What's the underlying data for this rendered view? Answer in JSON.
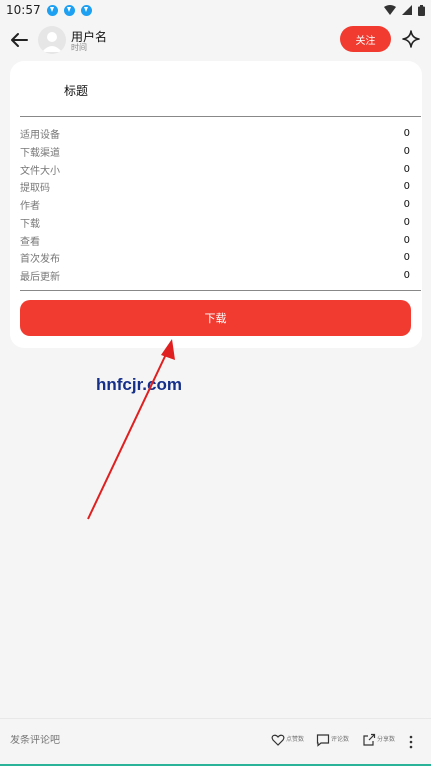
{
  "status_bar": {
    "time": "10:57",
    "notification_icons": [
      "download-icon",
      "download-icon",
      "download-icon"
    ],
    "right_icons": [
      "wifi-icon",
      "signal-icon",
      "battery-icon"
    ]
  },
  "header": {
    "back_icon": "arrow-left-icon",
    "user_name": "用户名",
    "time_label": "时间",
    "follow_label": "关注",
    "sparkle_icon": "sparkle-icon"
  },
  "card": {
    "title": "标题",
    "rows": [
      {
        "label": "适用设备",
        "value": "0"
      },
      {
        "label": "下载渠道",
        "value": "0"
      },
      {
        "label": "文件大小",
        "value": "0"
      },
      {
        "label": "提取码",
        "value": "0"
      },
      {
        "label": "作者",
        "value": "0"
      },
      {
        "label": "下载",
        "value": "0"
      },
      {
        "label": "查看",
        "value": "0"
      },
      {
        "label": "首次发布",
        "value": "0"
      },
      {
        "label": "最后更新",
        "value": "0"
      }
    ],
    "download_label": "下载"
  },
  "watermark": "hnfcjr.com",
  "bottom_bar": {
    "comment_placeholder": "发条评论吧",
    "actions": [
      {
        "icon": "heart-icon",
        "label": "点赞数"
      },
      {
        "icon": "comment-icon",
        "label": "评论数"
      },
      {
        "icon": "share-icon",
        "label": "分享数"
      }
    ],
    "more_icon": "more-vertical-icon"
  },
  "colors": {
    "accent": "#f23b30",
    "watermark": "#16308a",
    "arrow": "#e02020",
    "background": "#f5f5f5"
  }
}
